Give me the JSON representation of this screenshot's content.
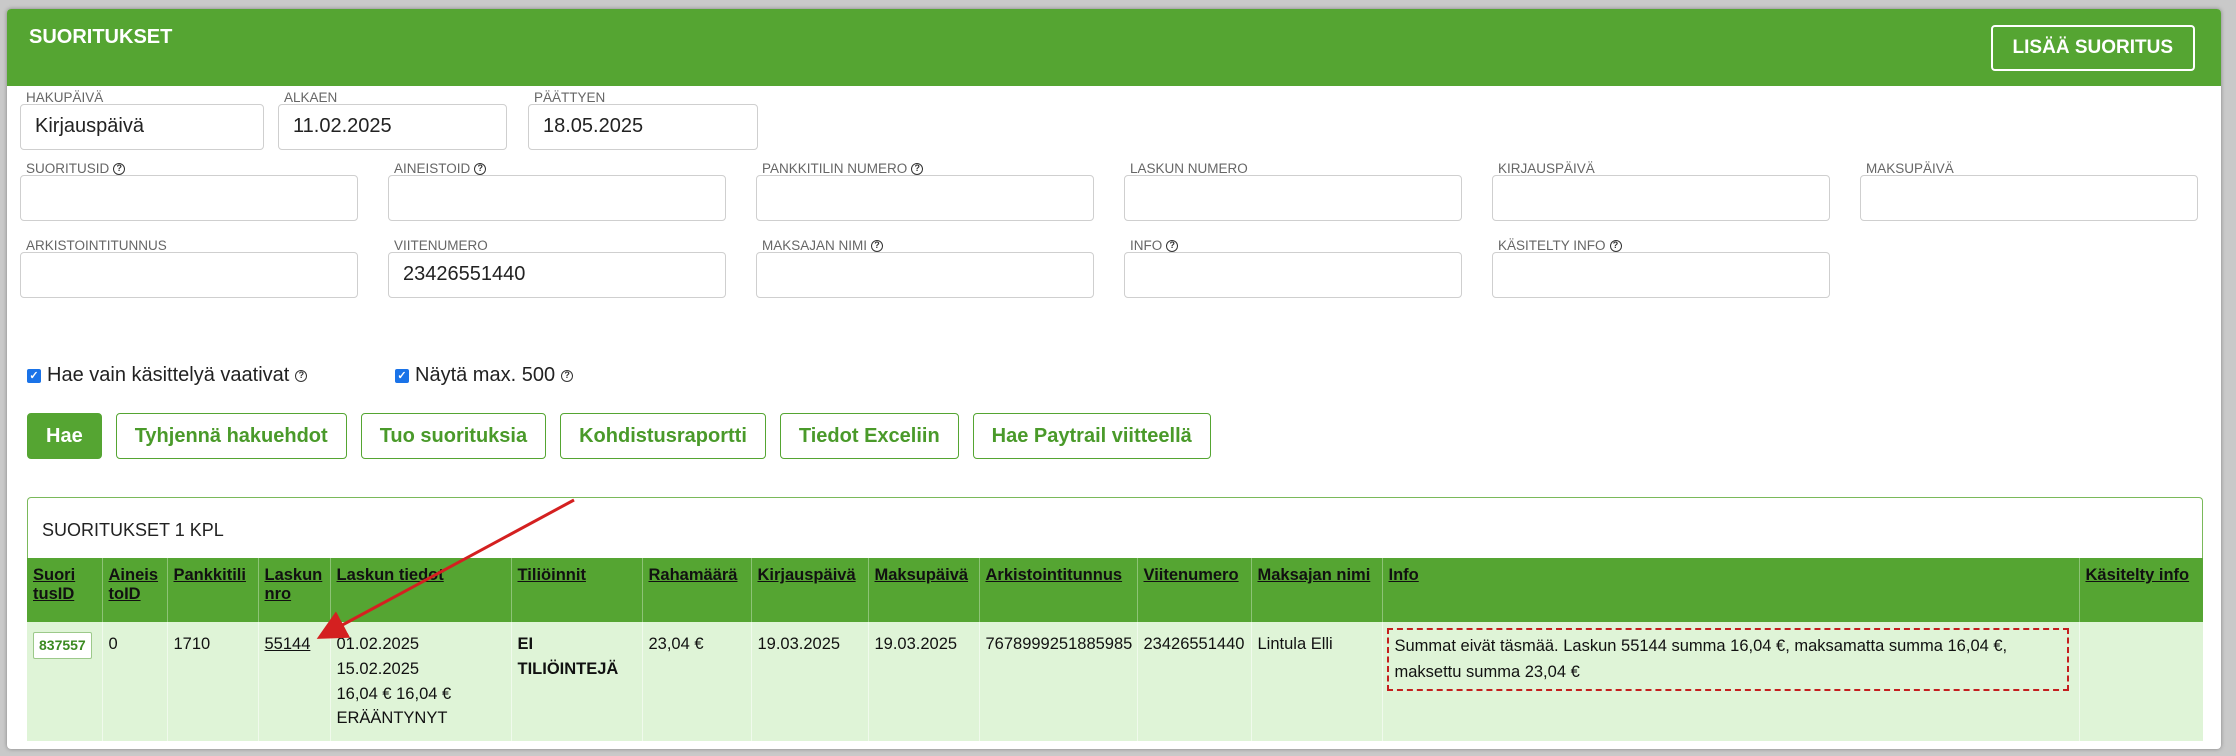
{
  "header": {
    "title": "SUORITUKSET",
    "add_button": "LISÄÄ SUORITUS"
  },
  "filters_top": [
    {
      "label": "HAKUPÄIVÄ",
      "value": "Kirjauspäivä"
    },
    {
      "label": "ALKAEN",
      "value": "11.02.2025"
    },
    {
      "label": "PÄÄTTYEN",
      "value": "18.05.2025"
    }
  ],
  "filters_row1": [
    {
      "label": "SUORITUSID",
      "help": true,
      "value": ""
    },
    {
      "label": "AINEISTOID",
      "help": true,
      "value": ""
    },
    {
      "label": "PANKKITILIN NUMERO",
      "help": true,
      "value": ""
    },
    {
      "label": "LASKUN NUMERO",
      "help": false,
      "value": ""
    },
    {
      "label": "KIRJAUSPÄIVÄ",
      "help": false,
      "value": ""
    },
    {
      "label": "MAKSUPÄIVÄ",
      "help": false,
      "value": ""
    }
  ],
  "filters_row2": [
    {
      "label": "ARKISTOINTITUNNUS",
      "help": false,
      "value": ""
    },
    {
      "label": "VIITENUMERO",
      "help": false,
      "value": "23426551440"
    },
    {
      "label": "MAKSAJAN NIMI",
      "help": true,
      "value": ""
    },
    {
      "label": "INFO",
      "help": true,
      "value": ""
    },
    {
      "label": "KÄSITELTY INFO",
      "help": true,
      "value": ""
    }
  ],
  "checkboxes": [
    {
      "label": "Hae vain käsittelyä vaativat",
      "checked": true
    },
    {
      "label": "Näytä max. 500",
      "checked": true
    }
  ],
  "buttons": {
    "search": "Hae",
    "clear": "Tyhjennä hakuehdot",
    "import": "Tuo suorituksia",
    "report": "Kohdistusraportti",
    "excel": "Tiedot Exceliin",
    "paytrail": "Hae Paytrail viitteellä"
  },
  "results": {
    "title": "SUORITUKSET 1 KPL",
    "columns": [
      "Suori tusID",
      "Aineis toID",
      "Pankkitili",
      "Laskun nro",
      "Laskun tiedot",
      "Tiliöinnit",
      "Rahamäärä",
      "Kirjauspäivä",
      "Maksupäivä",
      "Arkistointitunnus",
      "Viitenumero",
      "Maksajan nimi",
      "Info",
      "Käsitelty info"
    ],
    "row": {
      "suoritus_id": "837557",
      "aineisto_id": "0",
      "pankkitili": "1710",
      "laskun_nro": "55144",
      "laskun_tiedot_1": "01.02.2025 15.02.2025",
      "laskun_tiedot_2": "16,04 € 16,04 €",
      "laskun_tiedot_3": "ERÄÄNTYNYT",
      "tilioinnit": "EI TILIÖINTEJÄ",
      "rahamaara": "23,04 €",
      "kirjauspaiva": "19.03.2025",
      "maksupaiva": "19.03.2025",
      "arkistointitunnus": "7678999251885985",
      "viitenumero": "23426551440",
      "maksajan_nimi": "Lintula Elli",
      "info": "Summat eivät täsmää. Laskun 55144 summa 16,04 €, maksamatta summa 16,04 €, maksettu summa 23,04 €",
      "kasitelty_info": ""
    }
  },
  "colors": {
    "accent": "#55a532",
    "row_bg": "#dff4d7",
    "annotation": "#d42020"
  }
}
